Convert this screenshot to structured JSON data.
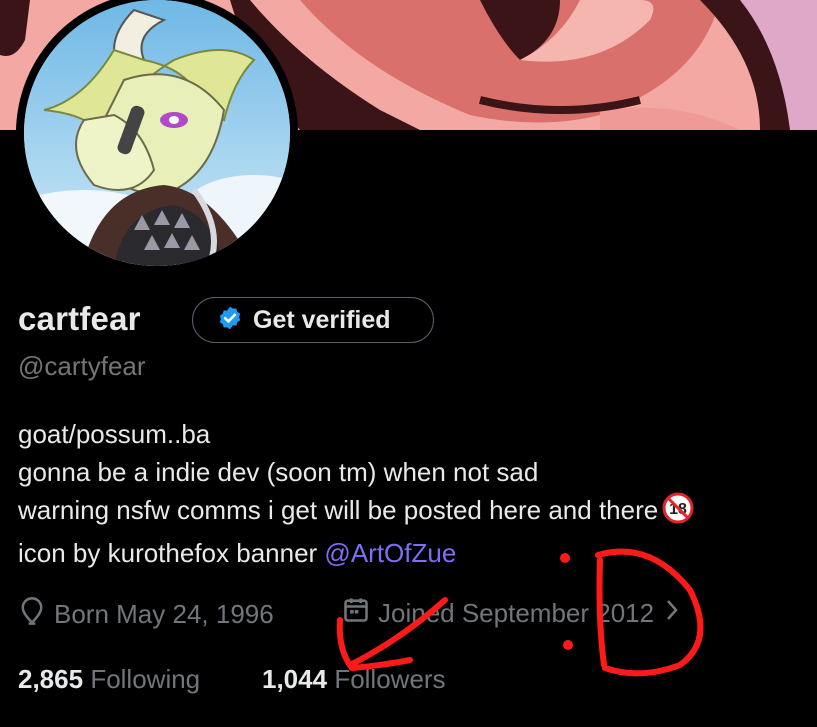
{
  "profile": {
    "display_name": "cartfear",
    "get_verified_label": "Get verified",
    "handle": "@cartyfear"
  },
  "bio": {
    "line1": "goat/possum..ba",
    "line2": "gonna be a  indie dev (soon tm) when not sad",
    "line3": "warning nsfw comms i get will be posted here and there",
    "adult_badge": "18",
    "line4_prefix": "icon by kurothefox banner ",
    "line4_link": "@ArtOfZue"
  },
  "meta": {
    "birthday": "Born May 24, 1996",
    "joined": "Joined September 2012",
    "icons": [
      "location-pin-icon",
      "calendar-icon",
      "chevron-right-icon"
    ]
  },
  "stats": {
    "following_count": "2,865",
    "following_label": "Following",
    "followers_count": "1,044",
    "followers_label": "Followers"
  },
  "colors": {
    "background": "#000000",
    "text_primary": "#e7e9ea",
    "text_secondary": "#71767b",
    "link": "#7f6df2",
    "verify_badge": "#1d9bf0",
    "annotation": "#ff1a1a"
  }
}
